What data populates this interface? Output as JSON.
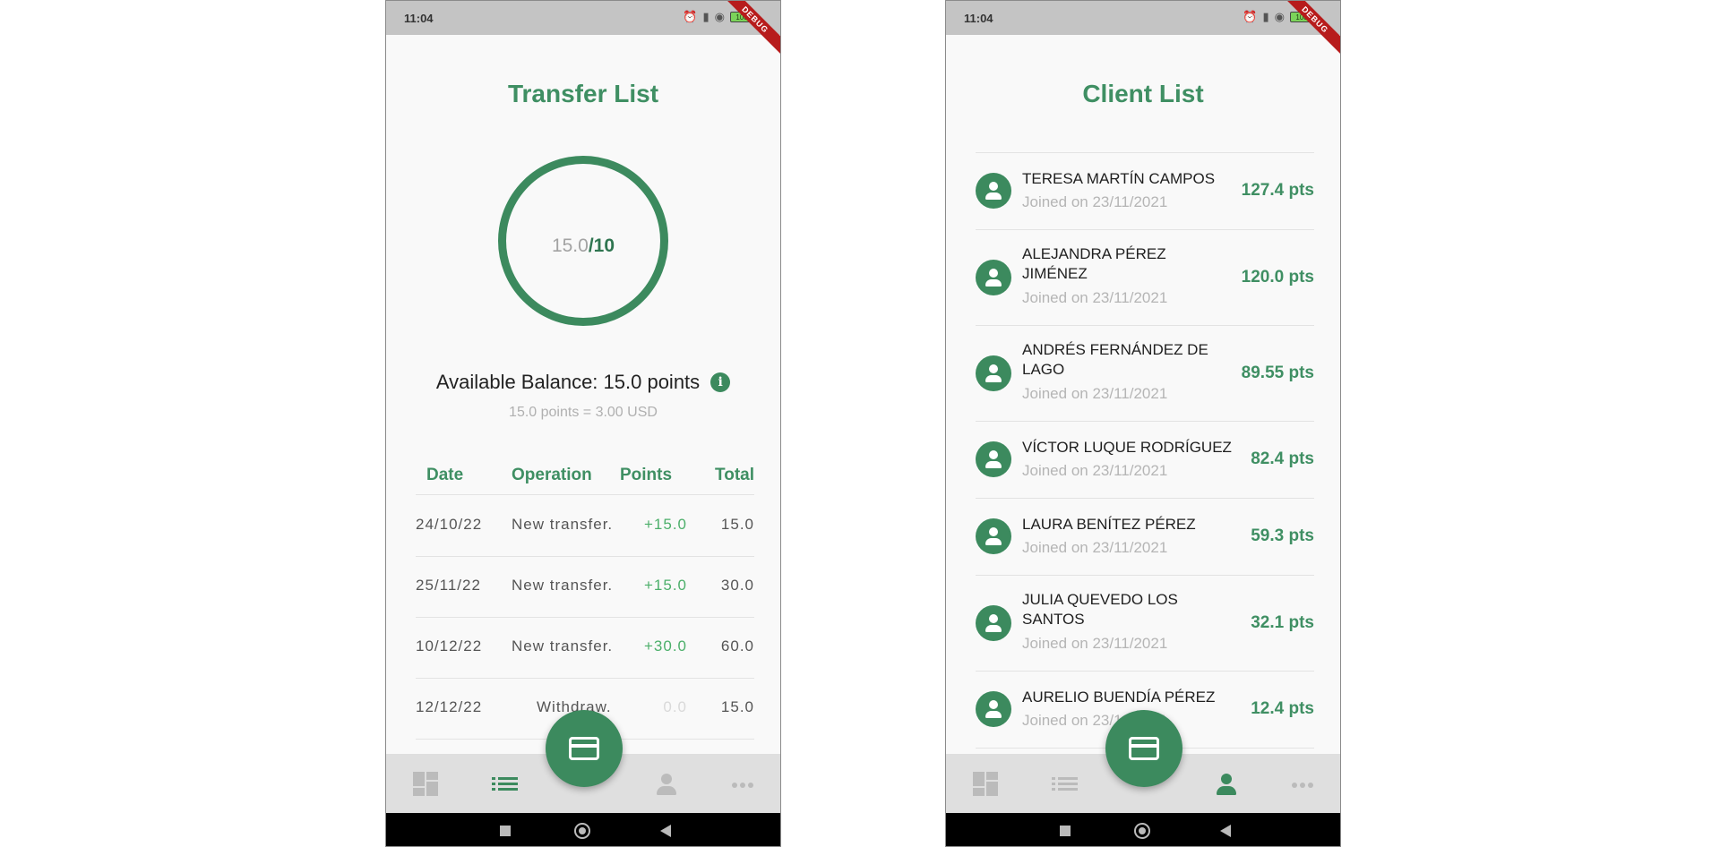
{
  "status_bar": {
    "time": "11:04",
    "battery": "100",
    "debug_label": "DEBUG"
  },
  "transfer_screen": {
    "title": "Transfer List",
    "ring": {
      "current": "15.0",
      "goal": "/10"
    },
    "balance_text": "Available Balance: 15.0 points",
    "conversion_text": "15.0 points = 3.00 USD",
    "table": {
      "headers": {
        "date": "Date",
        "operation": "Operation",
        "points": "Points",
        "total": "Total"
      },
      "rows": [
        {
          "date": "24/10/22",
          "operation": "New transfer.",
          "points": "+15.0",
          "total": "15.0"
        },
        {
          "date": "25/11/22",
          "operation": "New transfer.",
          "points": "+15.0",
          "total": "30.0"
        },
        {
          "date": "10/12/22",
          "operation": "New transfer.",
          "points": "+30.0",
          "total": "60.0"
        },
        {
          "date": "12/12/22",
          "operation": "Withdraw.",
          "points": "0.0",
          "total": "15.0"
        }
      ]
    }
  },
  "client_screen": {
    "title": "Client List",
    "clients": [
      {
        "name": "TERESA MARTÍN CAMPOS",
        "joined": "Joined on 23/11/2021",
        "points": "127.4 pts"
      },
      {
        "name": "ALEJANDRA PÉREZ JIMÉNEZ",
        "joined": "Joined on 23/11/2021",
        "points": "120.0 pts"
      },
      {
        "name": "ANDRÉS FERNÁNDEZ DE LAGO",
        "joined": "Joined on 23/11/2021",
        "points": "89.55 pts"
      },
      {
        "name": "VÍCTOR LUQUE RODRÍGUEZ",
        "joined": "Joined on 23/11/2021",
        "points": "82.4 pts"
      },
      {
        "name": "LAURA BENÍTEZ PÉREZ",
        "joined": "Joined on 23/11/2021",
        "points": "59.3 pts"
      },
      {
        "name": "JULIA QUEVEDO LOS SANTOS",
        "joined": "Joined on 23/11/2021",
        "points": "32.1 pts"
      },
      {
        "name": "AURELIO BUENDÍA PÉREZ",
        "joined": "Joined on 23/11/2021",
        "points": "12.4 pts"
      }
    ]
  },
  "colors": {
    "accent": "#3c8a5e",
    "positive": "#4caf6a",
    "muted": "#b0b0b0"
  },
  "icons": {
    "nav": [
      "dashboard-icon",
      "list-icon",
      "card-icon",
      "person-icon",
      "more-icon"
    ],
    "info": "info-icon"
  }
}
